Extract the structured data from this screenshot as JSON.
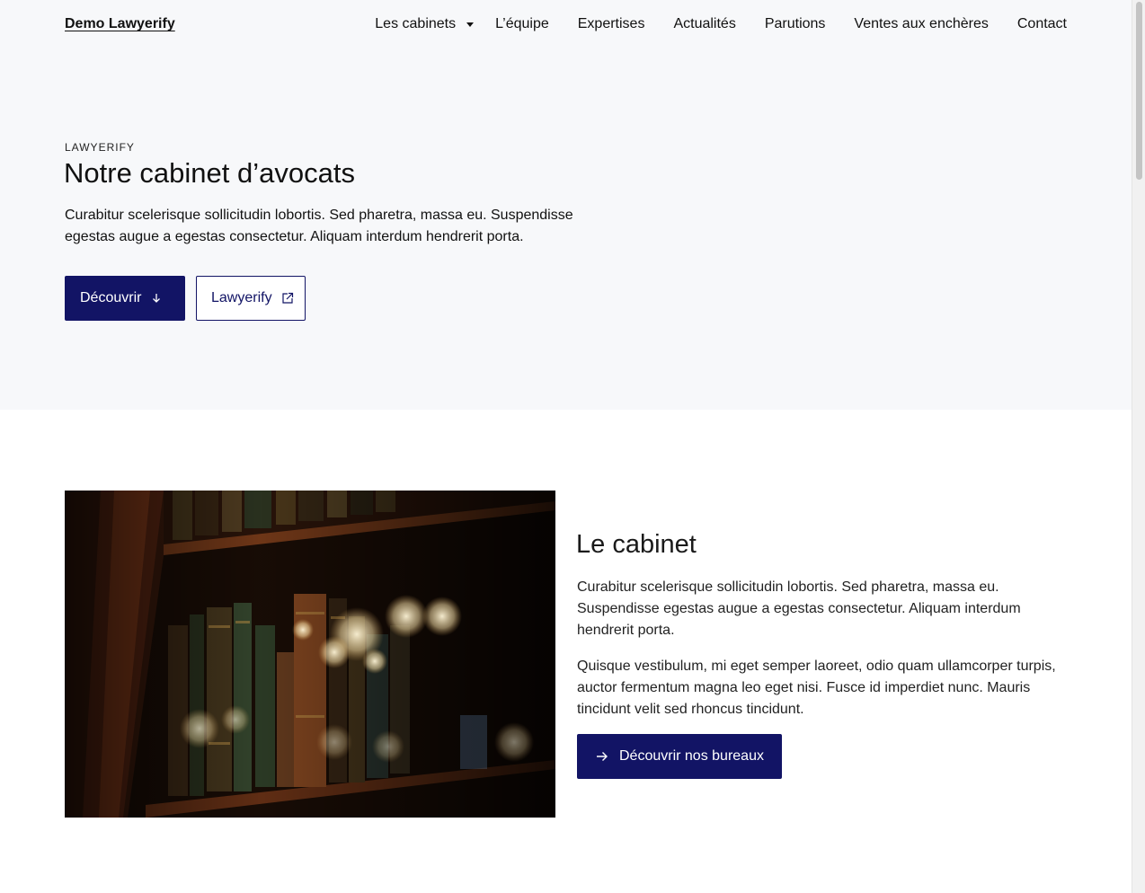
{
  "header": {
    "brand": "Demo Lawyerify",
    "nav": [
      {
        "label": "Les cabinets",
        "has_dropdown": true
      },
      {
        "label": "L’équipe"
      },
      {
        "label": "Expertises"
      },
      {
        "label": "Actualités"
      },
      {
        "label": "Parutions"
      },
      {
        "label": "Ventes aux enchères"
      },
      {
        "label": "Contact"
      }
    ]
  },
  "hero": {
    "eyebrow": "LAWYERIFY",
    "title": "Notre cabinet d’avocats",
    "text": "Curabitur scelerisque sollicitudin lobortis. Sed pharetra, massa eu. Suspendisse egestas augue a egestas consectetur. Aliquam interdum hendrerit porta.",
    "primary_button": {
      "label": "Découvrir",
      "icon": "arrow-down-icon"
    },
    "secondary_button": {
      "label": "Lawyerify",
      "icon": "external-link-icon"
    }
  },
  "cabinet": {
    "image": "bookshelf-photo",
    "title": "Le cabinet",
    "paragraph1": "Curabitur scelerisque sollicitudin lobortis. Sed pharetra, massa eu. Suspendisse egestas augue a egestas consectetur. Aliquam interdum hendrerit porta.",
    "paragraph2": "Quisque vestibulum, mi eget semper laoreet, odio quam ullamcorper turpis, auctor fermentum magna leo eget nisi. Fusce id imperdiet nunc. Mauris tincidunt velit sed rhoncus tincidunt.",
    "button": {
      "label": "Découvrir nos bureaux",
      "icon": "arrow-right-icon"
    }
  },
  "colors": {
    "accent": "#121465",
    "band_background": "#f7f8fa"
  }
}
